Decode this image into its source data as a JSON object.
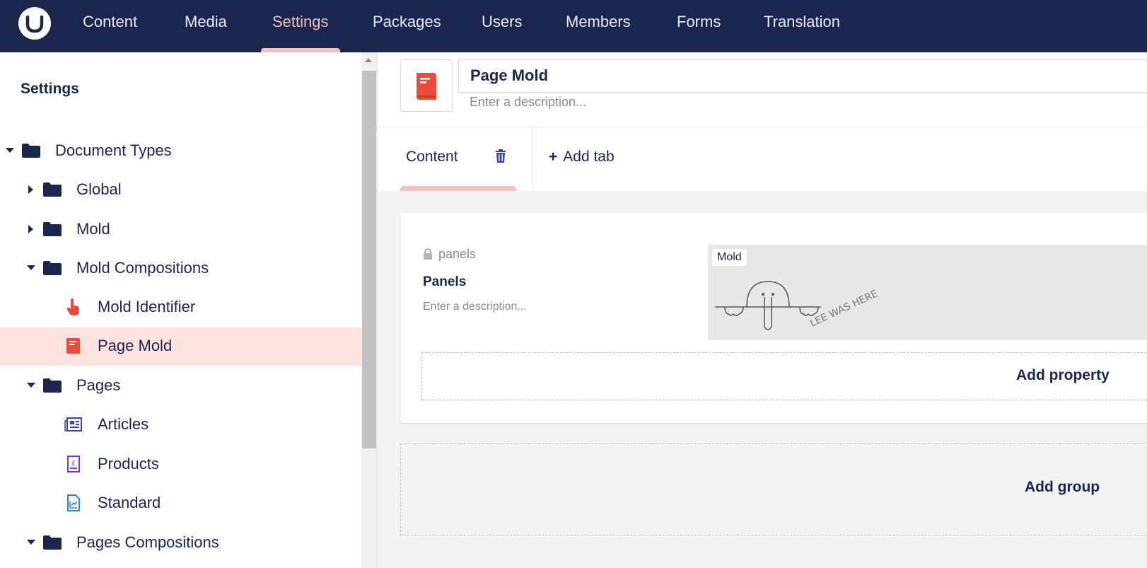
{
  "nav": {
    "items": [
      "Content",
      "Media",
      "Settings",
      "Packages",
      "Users",
      "Members",
      "Forms",
      "Translation"
    ],
    "active": "Settings"
  },
  "sidebar": {
    "title": "Settings",
    "tree": [
      {
        "label": "Document Types",
        "icon": "folder-icon",
        "expanded": true
      },
      {
        "label": "Global",
        "icon": "folder-icon",
        "expanded": false
      },
      {
        "label": "Mold",
        "icon": "folder-icon",
        "expanded": false
      },
      {
        "label": "Mold Compositions",
        "icon": "folder-icon",
        "expanded": true
      },
      {
        "label": "Mold Identifier",
        "icon": "pointer-hand-icon"
      },
      {
        "label": "Page Mold",
        "icon": "book-icon",
        "selected": true
      },
      {
        "label": "Pages",
        "icon": "folder-icon",
        "expanded": true
      },
      {
        "label": "Articles",
        "icon": "newspaper-icon"
      },
      {
        "label": "Products",
        "icon": "pound-receipt-icon"
      },
      {
        "label": "Standard",
        "icon": "document-chart-icon"
      },
      {
        "label": "Pages Compositions",
        "icon": "folder-icon",
        "expanded": true
      }
    ]
  },
  "editor": {
    "name": "Page Mold",
    "description_placeholder": "Enter a description...",
    "icon": "book-icon",
    "tabs": [
      {
        "label": "Content"
      }
    ],
    "add_tab_label": "Add tab",
    "property": {
      "alias": "panels",
      "name": "Panels",
      "description_placeholder": "Enter a description...",
      "preview_tag": "Mold",
      "preview_text": "LEE WAS HERE"
    },
    "add_property_label": "Add property",
    "add_group_label": "Add group"
  },
  "colors": {
    "nav_bg": "#1b264f",
    "accent": "#f5c1bc",
    "selected_row": "#fde3df",
    "icon_red": "#e94c3d"
  }
}
